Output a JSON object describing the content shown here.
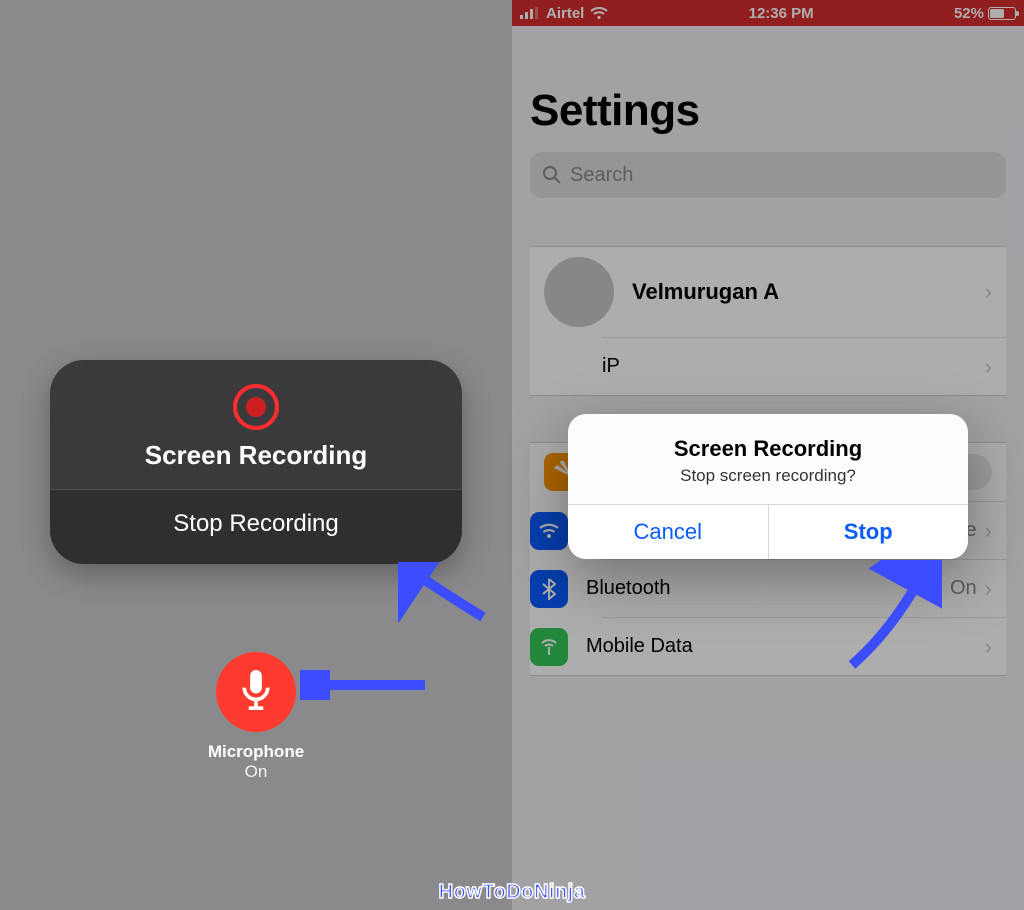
{
  "left_panel": {
    "card_title": "Screen Recording",
    "stop_label": "Stop Recording",
    "mic_label": "Microphone",
    "mic_state": "On"
  },
  "right_panel": {
    "statusbar": {
      "carrier": "Airtel",
      "time": "12:36 PM",
      "battery_pct": "52%"
    },
    "title": "Settings",
    "search_placeholder": "Search",
    "profile_name": "Velmurugan A",
    "rows": {
      "iphone": "iP",
      "airplane": "Airplane Mode",
      "wifi": "Wi-Fi",
      "wifi_value": "Mancave",
      "bluetooth": "Bluetooth",
      "bluetooth_value": "On",
      "mobile": "Mobile Data"
    },
    "alert": {
      "title": "Screen Recording",
      "message": "Stop screen recording?",
      "cancel": "Cancel",
      "stop": "Stop"
    }
  },
  "watermark": "HowToDoNinja",
  "colors": {
    "accent_blue": "#0a5cff",
    "record_red": "#ff3b30",
    "status_red": "#d72f2f",
    "arrow_blue": "#3c4cff"
  }
}
